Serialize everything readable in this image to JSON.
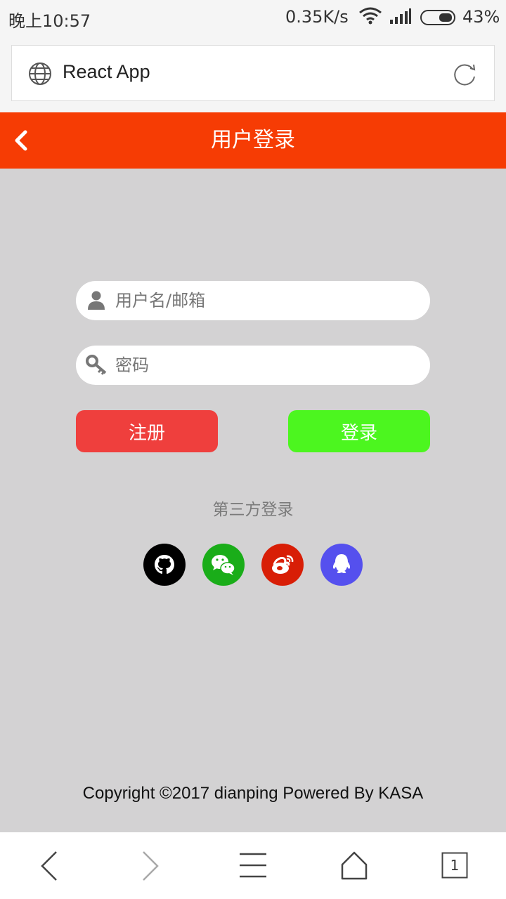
{
  "status": {
    "time": "晚上10:57",
    "speed": "0.35K/s",
    "battery": "43%"
  },
  "browser": {
    "title": "React App",
    "tab_count": "1"
  },
  "header": {
    "title": "用户登录"
  },
  "form": {
    "username_placeholder": "用户名/邮箱",
    "password_placeholder": "密码",
    "register_label": "注册",
    "login_label": "登录"
  },
  "third_party": {
    "label": "第三方登录",
    "providers": [
      "github-icon",
      "wechat-icon",
      "weibo-icon",
      "qq-icon"
    ],
    "colors": {
      "github": "#000000",
      "wechat": "#1aad19",
      "weibo": "#d81e06",
      "qq": "#5550ee"
    }
  },
  "footer": {
    "copyright": "Copyright ©2017 dianping Powered By KASA"
  },
  "theme": {
    "header_color": "#f63c04",
    "register_color": "#ef3f3d",
    "login_color": "#4cf61f",
    "background": "#d3d2d3"
  }
}
